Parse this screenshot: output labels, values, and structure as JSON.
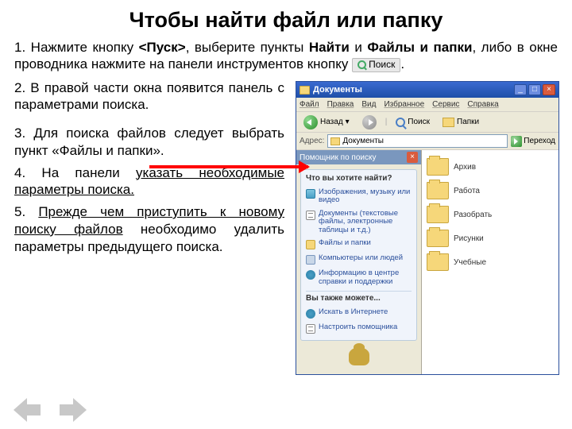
{
  "title": "Чтобы найти файл или папку",
  "step1": {
    "prefix": "1. Нажмите кнопку ",
    "pusk": "<Пуск>",
    "mid1": ", выберите пункты ",
    "naiti": "Найти",
    "and": " и ",
    "fip": "Файлы и папки",
    "mid2": ", либо в окне проводника нажмите на панели инструментов кнопку",
    "btn": "Поиск",
    "dot": "."
  },
  "step2": "2. В правой части окна появится панель с параметрами поиска.",
  "step3": "3. Для поиска файлов следует выбрать пункт «Файлы и папки».",
  "step4a": "4. На панели ",
  "step4b": "указать необходимые параметры поиска.",
  "step5a": "5. ",
  "step5b": "Прежде чем приступить к новому поиску файлов",
  "step5c": " необходимо удалить параметры предыдущего поиска.",
  "win": {
    "title": "Документы",
    "menu": {
      "file": "Файл",
      "edit": "Правка",
      "view": "Вид",
      "fav": "Избранное",
      "tools": "Сервис",
      "help": "Справка"
    },
    "toolbar": {
      "back": "Назад",
      "search": "Поиск",
      "folders": "Папки"
    },
    "addr": {
      "label": "Адрес:",
      "value": "Документы",
      "go": "Переход"
    },
    "search": {
      "header": "Помощник по поиску",
      "question": "Что вы хотите найти?",
      "options": [
        "Изображения, музыку или видео",
        "Документы (текстовые файлы, электронные таблицы и т.д.)",
        "Файлы и папки",
        "Компьютеры или людей",
        "Информацию в центре справки и поддержки"
      ],
      "also": "Вы также можете...",
      "also_opts": [
        "Искать в Интернете",
        "Настроить помощника"
      ]
    },
    "folders": [
      "Архив",
      "Работа",
      "Разобрать",
      "Рисунки",
      "Учебные"
    ]
  }
}
